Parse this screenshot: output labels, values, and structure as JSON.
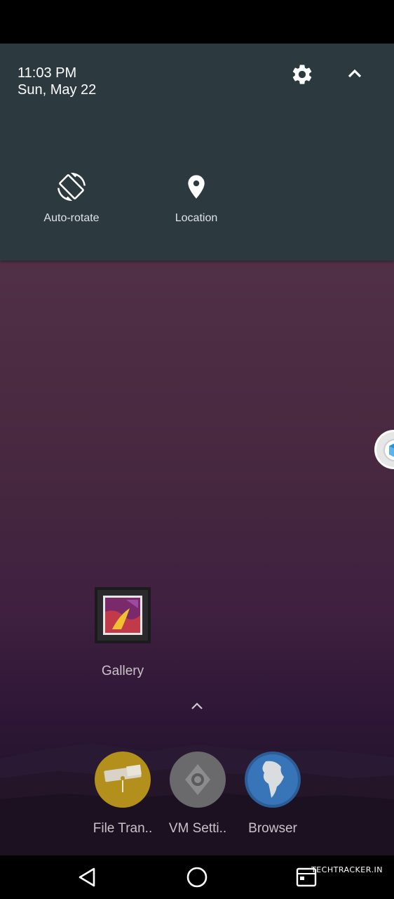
{
  "quick_settings": {
    "time": "11:03 PM",
    "date": "Sun, May 22",
    "settings_icon": "gear-icon",
    "collapse_icon": "chevron-up-icon",
    "tiles": [
      {
        "label": "Auto-rotate",
        "icon": "auto-rotate-icon"
      },
      {
        "label": "Location",
        "icon": "location-pin-icon"
      }
    ],
    "background": "#2c3a40"
  },
  "home": {
    "apps": [
      {
        "label": "Gallery",
        "icon": "gallery-icon"
      }
    ],
    "drawer_icon": "chevron-up-icon",
    "dock": [
      {
        "label": "File Tran..",
        "icon": "file-transfer-icon"
      },
      {
        "label": "VM Setti..",
        "icon": "vm-settings-icon"
      },
      {
        "label": "Browser",
        "icon": "globe-icon"
      }
    ]
  },
  "navigation": {
    "back": "back-triangle-icon",
    "home": "home-circle-icon",
    "recents": "recents-icon"
  },
  "watermark": "TECHTRACKER.IN"
}
